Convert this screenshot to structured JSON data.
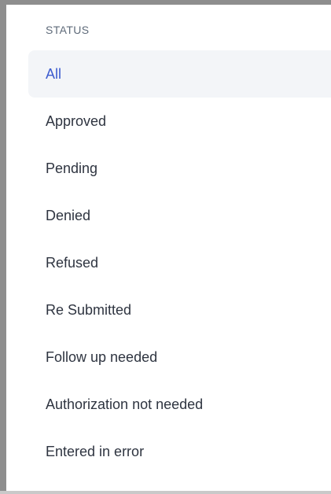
{
  "status_filter": {
    "header": "STATUS",
    "selected_index": 0,
    "items": [
      {
        "label": "All",
        "active": true
      },
      {
        "label": "Approved",
        "active": false
      },
      {
        "label": "Pending",
        "active": false
      },
      {
        "label": "Denied",
        "active": false
      },
      {
        "label": "Refused",
        "active": false
      },
      {
        "label": "Re Submitted",
        "active": false
      },
      {
        "label": "Follow up needed",
        "active": false
      },
      {
        "label": "Authorization not needed",
        "active": false
      },
      {
        "label": "Entered in error",
        "active": false
      }
    ]
  },
  "colors": {
    "active_text": "#3d5ccf",
    "active_background": "#f3f5f8",
    "item_text": "#2e3440",
    "header_text": "#5f6b7a",
    "frame_border": "#8e8e8e"
  }
}
